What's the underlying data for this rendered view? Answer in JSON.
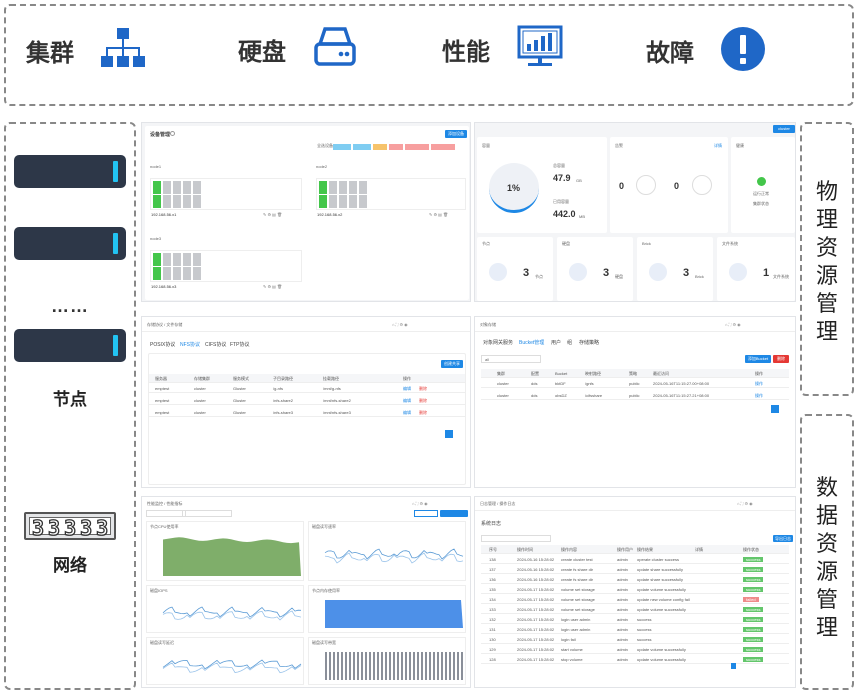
{
  "top": {
    "items": [
      {
        "label": "集群",
        "icon": "hierarchy-icon"
      },
      {
        "label": "硬盘",
        "icon": "disk-icon"
      },
      {
        "label": "性能",
        "icon": "monitor-chart-icon"
      },
      {
        "label": "故障",
        "icon": "alert-icon"
      }
    ],
    "icon_color": "#1f67c7"
  },
  "left": {
    "node_label": "节点",
    "dots": "……",
    "network_label": "网络",
    "network_digits": "33333"
  },
  "right": {
    "physical": "物理资源管理",
    "data": "数据资源管理"
  },
  "s1": {
    "title": "设备管理",
    "btn": "添加设备",
    "legend_label": "全选设备",
    "nodes": [
      "node1",
      "node2",
      "node3"
    ],
    "ips": [
      "192.168.56.x1",
      "192.168.56.x2",
      "192.168.56.x3"
    ]
  },
  "s2": {
    "btn": "cluster",
    "capacity_title": "容量",
    "capacity_pct": "1%",
    "total_label": "总容量",
    "total_value": "47.9",
    "total_unit": "GB",
    "used_label": "已用容量",
    "used_value": "442.0",
    "used_unit": "MB",
    "alarm_title": "告警",
    "alarm_link": "详情",
    "alarm_a": "0",
    "alarm_b": "0",
    "health_title": "健康",
    "health_status": "运行正常",
    "health_sub": "集群状态",
    "cards": [
      {
        "title": "节点",
        "value": "3",
        "unit": "节点"
      },
      {
        "title": "硬盘",
        "value": "3",
        "unit": "硬盘"
      },
      {
        "title": "Brick",
        "value": "3",
        "unit": "Brick"
      },
      {
        "title": "文件系统",
        "value": "1",
        "unit": "文件系统"
      }
    ]
  },
  "s3": {
    "breadcrumb": "存储协议 / 文件存储",
    "tabs": [
      "POSIX协议",
      "NFS协议",
      "CIFS协议",
      "FTP协议"
    ],
    "btn": "创建共享",
    "headers": [
      "服务器",
      "存储集群",
      "服务模式",
      "子目录路径",
      "挂载路径",
      "操作"
    ],
    "rows": [
      [
        "emptest",
        "cluster",
        "Gluster",
        "/g-nfs",
        "/mnt/g-nfs"
      ],
      [
        "emptest",
        "cluster",
        "Gluster",
        "/nfs-share2",
        "/mnt/nfs-share2"
      ],
      [
        "emptest",
        "cluster",
        "Gluster",
        "/nfs-share3",
        "/mnt/nfs-share3"
      ]
    ],
    "edit": "编辑",
    "del": "删除"
  },
  "s4": {
    "breadcrumb": "对象存储",
    "tabs": [
      "对象网关服务",
      "Bucket管理",
      "用户",
      "组",
      "存储策略"
    ],
    "select": "all",
    "btn_add": "添加Bucket",
    "btn_del": "删除",
    "headers": [
      "集群",
      "配置",
      "Bucket",
      "映射路径",
      "策略",
      "最近访问",
      "操作"
    ],
    "rows": [
      [
        "cluster",
        "dds",
        "bktDF",
        "/gnfs",
        "public",
        "2024-05-16T11:15:27.00+08:00"
      ],
      [
        "cluster",
        "dds",
        "obsDZ",
        "/cifsshare",
        "public",
        "2024-05-16T11:15:27.21+08:00"
      ]
    ],
    "op": "操作"
  },
  "s5": {
    "breadcrumb": "性能监控 / 性能指标",
    "charts": [
      "节点CPU使用率",
      "磁盘读写速率",
      "磁盘IOPS",
      "节点内存使用率",
      "磁盘读写延迟",
      "磁盘读写带宽"
    ]
  },
  "s6": {
    "breadcrumb": "日志管理 / 操作日志",
    "title": "系统日志",
    "btn": "导出日志",
    "headers": [
      "序号",
      "操作时间",
      "操作内容",
      "操作用户",
      "操作结果",
      "详情",
      "操作状态"
    ],
    "rows": [
      [
        "138",
        "2024-05-16 15:28:02",
        "create cluster test",
        "admin",
        "operate cluster success",
        "",
        "success"
      ],
      [
        "137",
        "2024-05-16 15:28:02",
        "create fs share dir",
        "admin",
        "update share successfully",
        "",
        "success"
      ],
      [
        "136",
        "2024-05-16 15:28:02",
        "create fs share dir",
        "admin",
        "update share successfully",
        "",
        "success"
      ],
      [
        "135",
        "2024-05-17 15:28:02",
        "volume set storage",
        "admin",
        "update volume successfully",
        "",
        "success"
      ],
      [
        "134",
        "2024-05-17 15:28:02",
        "volume set storage",
        "admin",
        "update new volume config fail",
        "",
        "failed"
      ],
      [
        "133",
        "2024-05-17 15:28:02",
        "volume set storage",
        "admin",
        "update volume successfully",
        "",
        "success"
      ],
      [
        "132",
        "2024-05-17 15:28:02",
        "login user admin",
        "admin",
        "success",
        "",
        "success"
      ],
      [
        "131",
        "2024-05-17 15:28:02",
        "login user admin",
        "admin",
        "success",
        "",
        "success"
      ],
      [
        "130",
        "2024-05-17 15:28:02",
        "login fail",
        "admin",
        "success",
        "",
        "success"
      ],
      [
        "129",
        "2024-05-17 15:28:02",
        "start volume",
        "admin",
        "update volume successfully",
        "",
        "success"
      ],
      [
        "128",
        "2024-05-17 15:28:02",
        "stop volume",
        "admin",
        "update volume successfully",
        "",
        "success"
      ]
    ]
  }
}
